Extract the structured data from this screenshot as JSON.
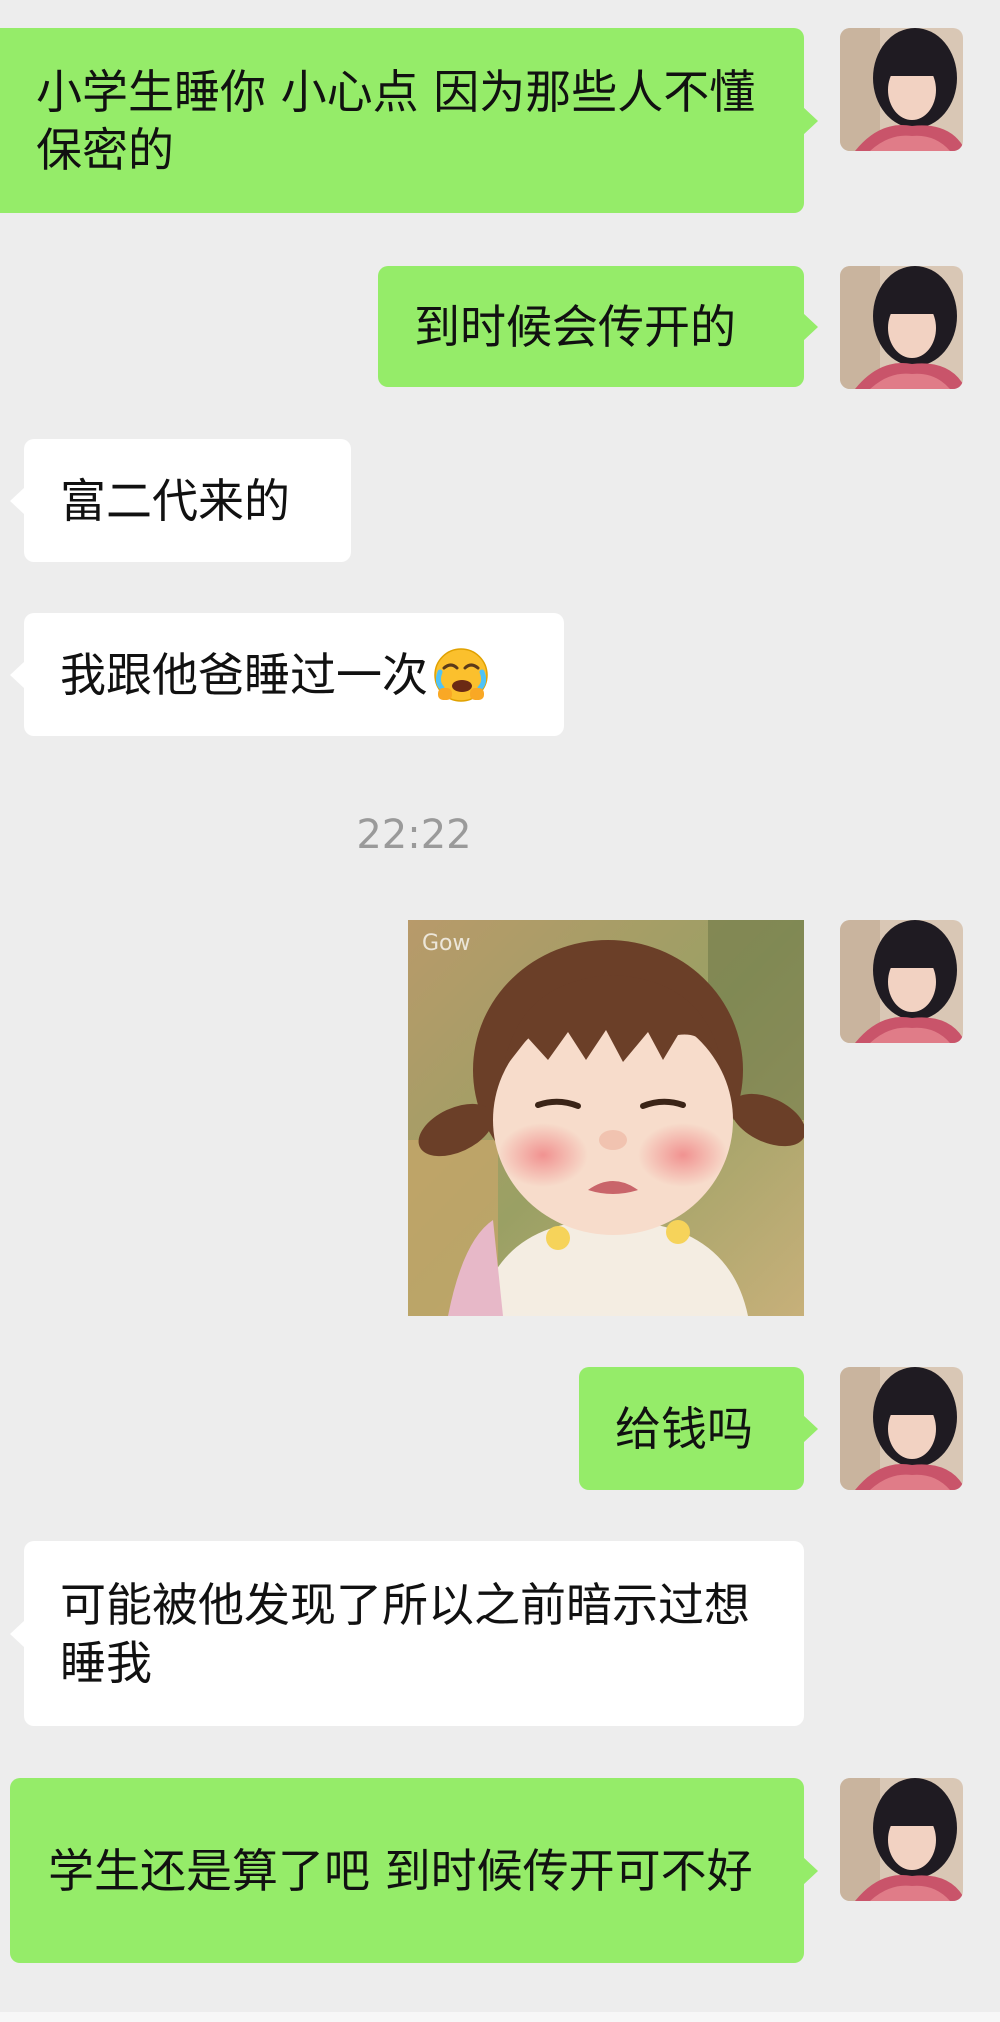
{
  "messages": [
    {
      "side": "sent",
      "text": "小学生睡你 小心点 因为那些人不懂保密的"
    },
    {
      "side": "sent",
      "text": "到时候会传开的"
    },
    {
      "side": "recv",
      "text": "富二代来的"
    },
    {
      "side": "recv",
      "text": "我跟他爸睡过一次"
    },
    {
      "side": "sent",
      "text": "给钱吗"
    },
    {
      "side": "recv",
      "text": "可能被他发现了所以之前暗示过想睡我"
    },
    {
      "side": "sent",
      "text": "学生还是算了吧 到时候传开可不好"
    }
  ],
  "timestamp": "22:22",
  "sticker": {
    "watermark": "Gow"
  },
  "emoji": "face-holding-back-tears-laughing",
  "colors": {
    "background": "#ededed",
    "sent_bubble": "#95ec69",
    "recv_bubble": "#ffffff",
    "timestamp": "#9a9a9a"
  }
}
